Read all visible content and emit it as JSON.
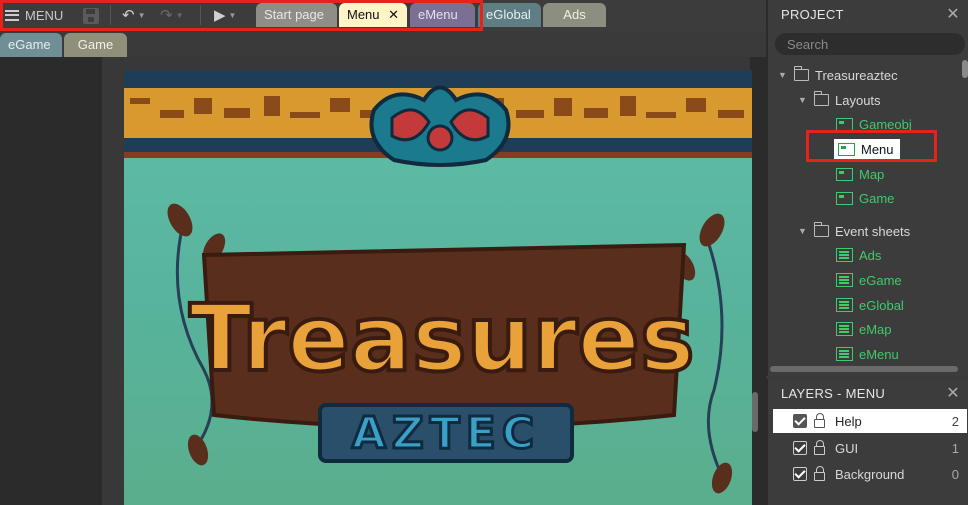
{
  "toolbar": {
    "menu_label": "MENU",
    "icons": {
      "menu": "hamburger-icon",
      "save": "save-icon",
      "undo": "undo-icon",
      "redo": "redo-icon",
      "play": "play-icon"
    }
  },
  "tabs": [
    {
      "label": "Start page"
    },
    {
      "label": "Menu",
      "active": true,
      "close": "✕"
    },
    {
      "label": "eMenu"
    },
    {
      "label": "eGlobal"
    },
    {
      "label": "Ads"
    }
  ],
  "tabs_row2": [
    {
      "label": "eGame"
    },
    {
      "label": "Game"
    }
  ],
  "project": {
    "title": "PROJECT",
    "search_placeholder": "Search",
    "root": "Treasureaztec",
    "layouts_folder": "Layouts",
    "layouts": [
      "Gameobj",
      "Menu",
      "Map",
      "Game"
    ],
    "selected_layout": "Menu",
    "eventsheets_folder": "Event sheets",
    "eventsheets": [
      "Ads",
      "eGame",
      "eGlobal",
      "eMap",
      "eMenu"
    ]
  },
  "layers": {
    "title": "LAYERS - MENU",
    "items": [
      {
        "name": "Help",
        "index": "2",
        "active": true
      },
      {
        "name": "GUI",
        "index": "1"
      },
      {
        "name": "Background",
        "index": "0"
      }
    ]
  },
  "scene": {
    "logo_text": "Treasures",
    "logo_subtext": "AZTEC",
    "colors": {
      "sky": "#5fbda7",
      "band": "#1f3d56",
      "gold": "#e9a23a",
      "vine": "#274057"
    }
  }
}
